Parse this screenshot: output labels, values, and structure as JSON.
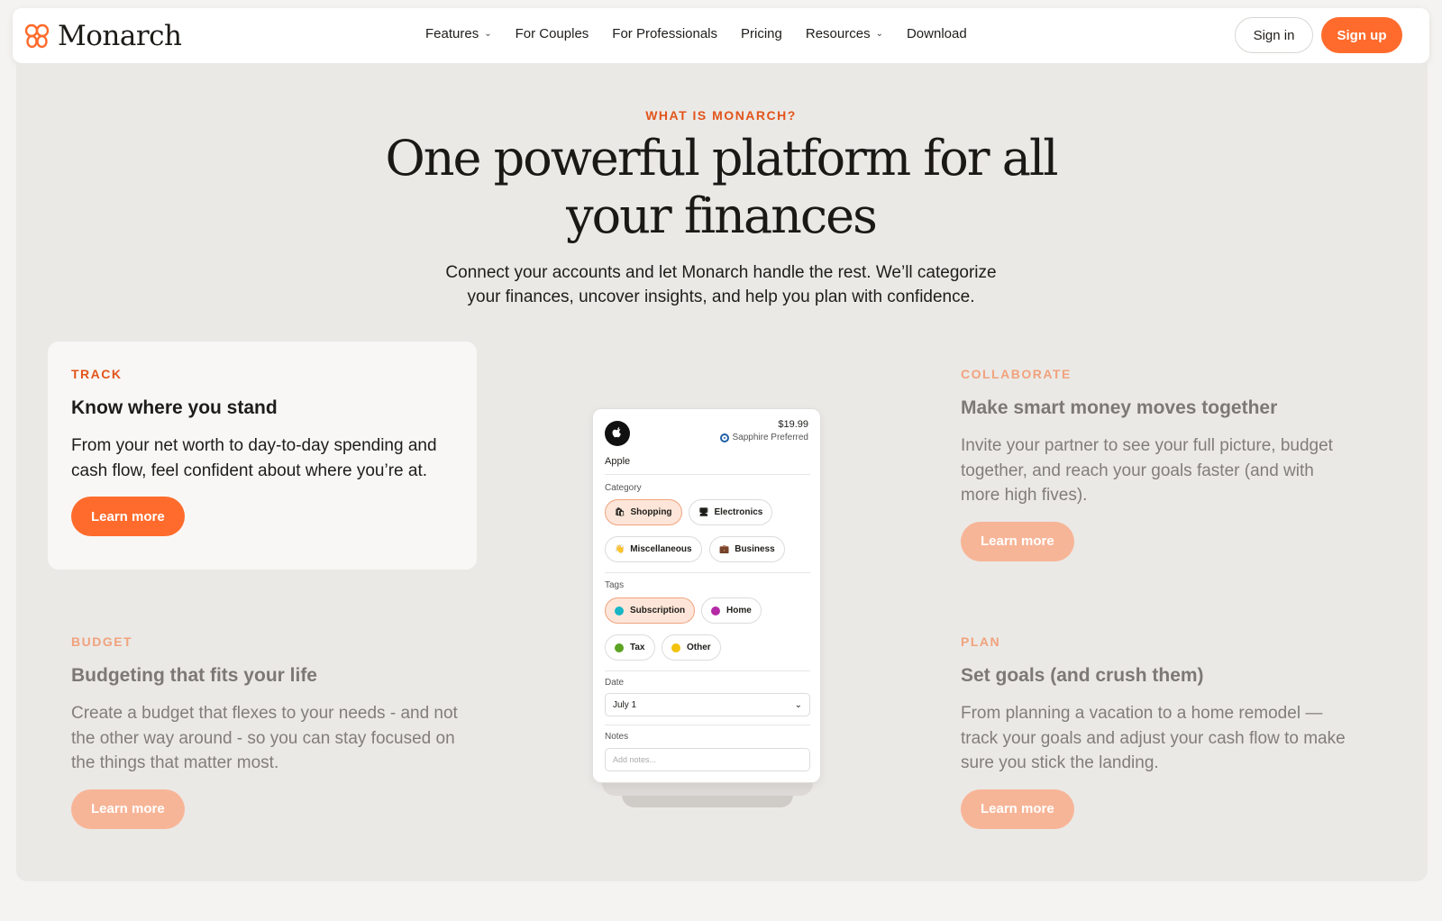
{
  "nav": {
    "logo_text": "Monarch",
    "links": [
      {
        "label": "Features",
        "dropdown": true
      },
      {
        "label": "For Couples",
        "dropdown": false
      },
      {
        "label": "For Professionals",
        "dropdown": false
      },
      {
        "label": "Pricing",
        "dropdown": false
      },
      {
        "label": "Resources",
        "dropdown": true
      },
      {
        "label": "Download",
        "dropdown": false
      }
    ],
    "signin_label": "Sign in",
    "signup_label": "Sign up"
  },
  "hero": {
    "eyebrow": "WHAT IS MONARCH?",
    "headline_line1": "One powerful platform for all",
    "headline_line2": "your finances",
    "subtext_line1": "Connect your accounts and let Monarch handle the rest. We’ll categorize",
    "subtext_line2": "your finances, uncover insights, and help you plan with confidence."
  },
  "features": {
    "track": {
      "label": "TRACK",
      "title": "Know where you stand",
      "desc": "From your net worth to day-to-day spending and cash flow, feel confident about where you’re at.",
      "button": "Learn more"
    },
    "collaborate": {
      "label": "COLLABORATE",
      "title": "Make smart money moves together",
      "desc": "Invite your partner to see your full picture, budget together, and reach your goals faster (and with more high fives).",
      "button": "Learn more"
    },
    "budget": {
      "label": "BUDGET",
      "title": "Budgeting that fits your life",
      "desc": "Create a budget that flexes to your needs - and not the other way around - so you can stay focused on the things that matter most.",
      "button": "Learn more"
    },
    "plan": {
      "label": "PLAN",
      "title": "Set goals (and crush them)",
      "desc": "From planning a vacation to a home remodel — track your goals and adjust your cash flow to make sure you stick the landing.",
      "button": "Learn more"
    }
  },
  "phone": {
    "merchant": "Apple",
    "amount": "$19.99",
    "account": "Sapphire Preferred",
    "category_label": "Category",
    "categories": [
      {
        "label": "Shopping",
        "icon": "🛍",
        "selected": true
      },
      {
        "label": "Electronics",
        "icon": "🖥",
        "selected": false
      },
      {
        "label": "Miscellaneous",
        "icon": "👋",
        "selected": false
      },
      {
        "label": "Business",
        "icon": "💼",
        "selected": false
      }
    ],
    "tags_label": "Tags",
    "tags": [
      {
        "label": "Subscription",
        "color": "#19b5c4",
        "selected": true
      },
      {
        "label": "Home",
        "color": "#b42aa6",
        "selected": false
      },
      {
        "label": "Tax",
        "color": "#5aa422",
        "selected": false
      },
      {
        "label": "Other",
        "color": "#f3c20c",
        "selected": false
      }
    ],
    "date_label": "Date",
    "date_value": "July 1",
    "notes_label": "Notes",
    "notes_placeholder": "Add notes..."
  },
  "colors": {
    "accent": "#ff6b2c",
    "accent_text": "#e2541b",
    "accent_dim": "#f7b597",
    "section_bg": "#ebe9e6"
  }
}
